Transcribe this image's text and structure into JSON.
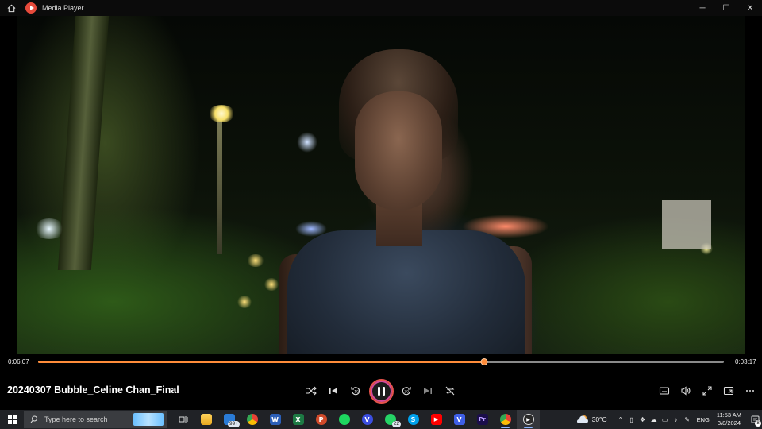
{
  "window": {
    "title": "Media Player",
    "controls": {
      "minimize": "─",
      "maximize": "☐",
      "close": "✕"
    }
  },
  "player": {
    "current_time": "0:06:07",
    "remaining_time": "0:03:17",
    "progress_fraction": 0.65,
    "media_title": "20240307 Bubble_Celine Chan_Final",
    "accent_color": "#ff8c3a"
  },
  "taskbar": {
    "search_placeholder": "Type here to search",
    "apps": [
      {
        "name": "task-view",
        "label": ""
      },
      {
        "name": "file-explorer",
        "label": ""
      },
      {
        "name": "outlook",
        "label": "",
        "badge": "99+"
      },
      {
        "name": "chrome",
        "label": ""
      },
      {
        "name": "word",
        "label": "W"
      },
      {
        "name": "excel",
        "label": "X"
      },
      {
        "name": "powerpoint",
        "label": "P"
      },
      {
        "name": "spotify",
        "label": ""
      },
      {
        "name": "vpn",
        "label": "V"
      },
      {
        "name": "whatsapp",
        "label": "",
        "badge": "22"
      },
      {
        "name": "skype",
        "label": "S"
      },
      {
        "name": "youtube",
        "label": "▶"
      },
      {
        "name": "vegas",
        "label": "V"
      },
      {
        "name": "premiere",
        "label": "Pr"
      },
      {
        "name": "chrome-2",
        "label": ""
      },
      {
        "name": "media-player",
        "label": ""
      }
    ],
    "weather_temp": "30°C",
    "language": "ENG",
    "time": "11:53 AM",
    "date": "3/8/2024",
    "notification_count": "8"
  }
}
